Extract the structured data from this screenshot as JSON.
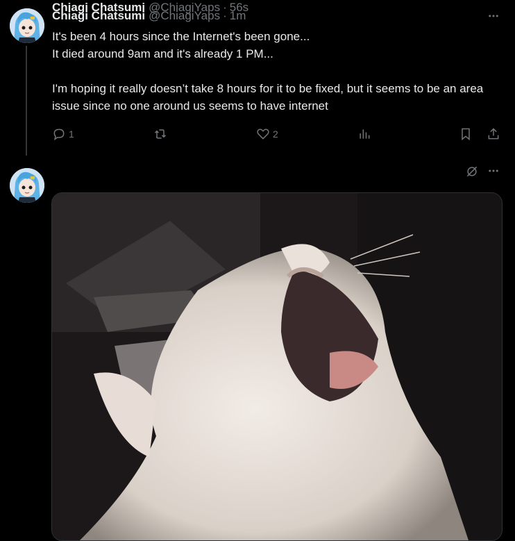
{
  "tweets": [
    {
      "display_name": "Chiagi Chatsumi",
      "handle": "@ChiagiYaps",
      "separator": "·",
      "time": "1m",
      "text": "It's been 4 hours since the Internet's been gone...\nIt died around 9am and it's already 1 PM...\n\nI'm hoping it really doesn’t take 8 hours for it to be fixed, but it seems to be an area issue since no one around us seems to have internet",
      "replies": "1",
      "reposts": "",
      "likes": "2",
      "views": ""
    },
    {
      "display_name": "Chiagi Chatsumi",
      "handle": "@ChiagiYaps",
      "separator": "·",
      "time": "56s",
      "media": "white-cat-yawning-photo"
    }
  ],
  "icons": {
    "more": "more-horizontal-icon",
    "reply": "reply-icon",
    "repost": "repost-icon",
    "like": "like-icon",
    "views": "views-icon",
    "bookmark": "bookmark-icon",
    "share": "share-icon",
    "grok": "grok-icon"
  },
  "colors": {
    "background": "#000000",
    "text": "#e7e9ea",
    "muted": "#71767b",
    "thread_line": "#333639"
  }
}
